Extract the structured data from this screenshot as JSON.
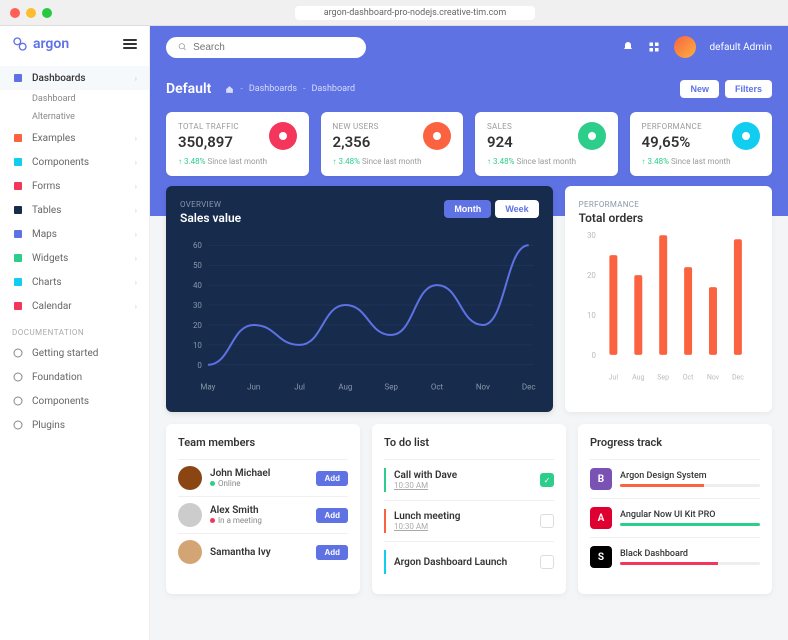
{
  "browser": {
    "url": "argon-dashboard-pro-nodejs.creative-tim.com"
  },
  "brand": "argon",
  "search": {
    "placeholder": "Search"
  },
  "user": {
    "name": "default Admin"
  },
  "sidebar": {
    "items": [
      {
        "label": "Dashboards",
        "icon": "#5e72e4",
        "active": true,
        "sub": [
          "Dashboard",
          "Alternative"
        ]
      },
      {
        "label": "Examples",
        "icon": "#fb6340"
      },
      {
        "label": "Components",
        "icon": "#11cdef"
      },
      {
        "label": "Forms",
        "icon": "#f5365c"
      },
      {
        "label": "Tables",
        "icon": "#172b4d"
      },
      {
        "label": "Maps",
        "icon": "#5e72e4"
      },
      {
        "label": "Widgets",
        "icon": "#2dce89"
      },
      {
        "label": "Charts",
        "icon": "#11cdef"
      },
      {
        "label": "Calendar",
        "icon": "#f5365c"
      }
    ],
    "docSection": "DOCUMENTATION",
    "docs": [
      {
        "label": "Getting started"
      },
      {
        "label": "Foundation"
      },
      {
        "label": "Components"
      },
      {
        "label": "Plugins"
      }
    ]
  },
  "page": {
    "title": "Default",
    "crumbs": [
      "Dashboards",
      "Dashboard"
    ],
    "actions": [
      "New",
      "Filters"
    ]
  },
  "stats": [
    {
      "label": "TOTAL TRAFFIC",
      "value": "350,897",
      "pct": "3.48%",
      "since": "Since last month",
      "color": "#f5365c"
    },
    {
      "label": "NEW USERS",
      "value": "2,356",
      "pct": "3.48%",
      "since": "Since last month",
      "color": "#fb6340"
    },
    {
      "label": "SALES",
      "value": "924",
      "pct": "3.48%",
      "since": "Since last month",
      "color": "#2dce89"
    },
    {
      "label": "PERFORMANCE",
      "value": "49,65%",
      "pct": "3.48%",
      "since": "Since last month",
      "color": "#11cdef"
    }
  ],
  "salesChart": {
    "overline": "OVERVIEW",
    "title": "Sales value",
    "toggle": [
      "Month",
      "Week"
    ]
  },
  "ordersChart": {
    "overline": "PERFORMANCE",
    "title": "Total orders"
  },
  "chart_data": [
    {
      "type": "line",
      "title": "Sales value",
      "categories": [
        "May",
        "Jun",
        "Jul",
        "Aug",
        "Sep",
        "Oct",
        "Nov",
        "Dec"
      ],
      "values": [
        0,
        20,
        10,
        30,
        15,
        40,
        20,
        60
      ],
      "ylim": [
        0,
        60
      ],
      "xlabel": "",
      "ylabel": ""
    },
    {
      "type": "bar",
      "title": "Total orders",
      "categories": [
        "Jul",
        "Aug",
        "Sep",
        "Oct",
        "Nov",
        "Dec"
      ],
      "values": [
        25,
        20,
        30,
        22,
        17,
        29
      ],
      "ylim": [
        0,
        30
      ],
      "xlabel": "",
      "ylabel": ""
    }
  ],
  "ylabels_sales": [
    "60",
    "50",
    "40",
    "30",
    "20",
    "10",
    "0"
  ],
  "ylabels_orders": [
    "30",
    "20",
    "10",
    "0"
  ],
  "panels": {
    "team": {
      "title": "Team members",
      "members": [
        {
          "name": "John Michael",
          "status": "Online",
          "dot": "#2dce89",
          "btn": "Add",
          "avatar": "#8b4513"
        },
        {
          "name": "Alex Smith",
          "status": "In a meeting",
          "dot": "#f5365c",
          "btn": "Add",
          "avatar": "#ccc"
        },
        {
          "name": "Samantha Ivy",
          "status": "",
          "dot": "",
          "btn": "Add",
          "avatar": "#d4a574"
        }
      ]
    },
    "todo": {
      "title": "To do list",
      "items": [
        {
          "title": "Call with Dave",
          "time": "10:30 AM",
          "color": "#2dce89",
          "checked": true
        },
        {
          "title": "Lunch meeting",
          "time": "10:30 AM",
          "color": "#fb6340",
          "checked": false
        },
        {
          "title": "Argon Dashboard Launch",
          "time": "",
          "color": "#11cdef",
          "checked": false
        }
      ]
    },
    "progress": {
      "title": "Progress track",
      "items": [
        {
          "name": "Argon Design System",
          "icon": "B",
          "iconbg": "#7952b3",
          "pct": 60,
          "color": "#fb6340"
        },
        {
          "name": "Angular Now UI Kit PRO",
          "icon": "A",
          "iconbg": "#dd0031",
          "pct": 100,
          "color": "#2dce89"
        },
        {
          "name": "Black Dashboard",
          "icon": "S",
          "iconbg": "#000",
          "pct": 70,
          "color": "#f5365c"
        }
      ]
    }
  }
}
